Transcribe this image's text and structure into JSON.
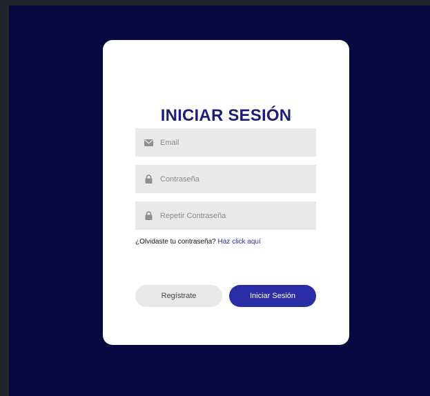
{
  "login": {
    "title": "INICIAR SESIÓN",
    "email_placeholder": "Email",
    "password_placeholder": "Contraseña",
    "repeat_password_placeholder": "Repetir Contraseña",
    "forgot_text": "¿Olvidaste tu contraseña?",
    "forgot_link": "Haz click aquí",
    "register_label": "Regístrate",
    "login_label": "Iniciar Sesión"
  },
  "icons": {
    "email": "envelope-icon",
    "password": "lock-icon",
    "repeat_password": "lock-icon"
  },
  "colors": {
    "background": "#06093f",
    "frame": "#22252b",
    "card": "#ffffff",
    "title": "#1b1d78",
    "accent": "#2a2ea6",
    "input_bg": "#e9e9e9"
  }
}
